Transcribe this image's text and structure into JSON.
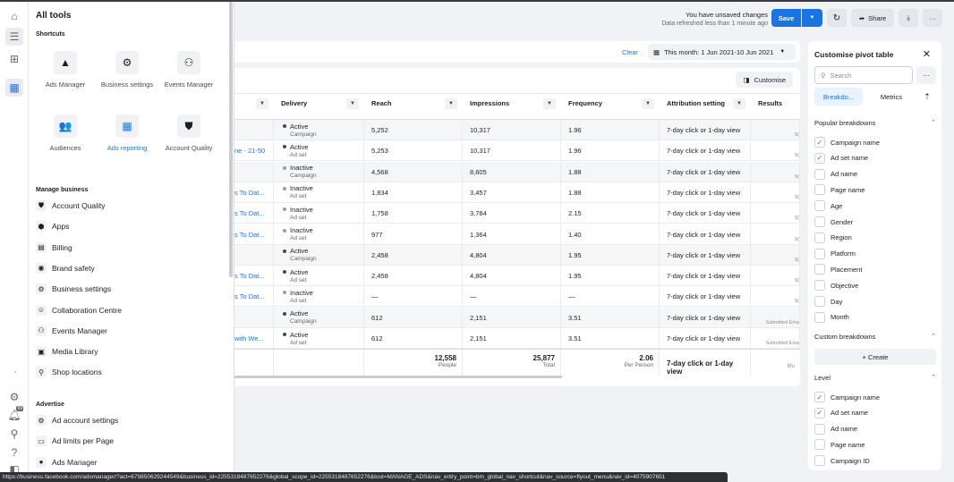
{
  "rail": {
    "icons": [
      "home-icon",
      "menu-icon",
      "notebook-add-icon",
      "ads-reporting-icon"
    ],
    "bottom_icons": [
      "settings-icon",
      "notifications-icon",
      "search-icon",
      "help-icon",
      "panel-icon"
    ],
    "notification_badge": "99"
  },
  "flyout": {
    "title": "All tools",
    "shortcuts_label": "Shortcuts",
    "shortcuts": [
      {
        "label": "Ads Manager",
        "icon": "ads-manager-icon",
        "glyph": "▲",
        "active": false
      },
      {
        "label": "Business settings",
        "icon": "gear-icon",
        "glyph": "⚙",
        "active": false
      },
      {
        "label": "Events Manager",
        "icon": "events-manager-icon",
        "glyph": "⚇",
        "active": false
      },
      {
        "label": "Audiences",
        "icon": "audiences-icon",
        "glyph": "👥",
        "active": false
      },
      {
        "label": "Ads reporting",
        "icon": "ads-reporting-icon",
        "glyph": "▦",
        "active": true
      },
      {
        "label": "Account Quality",
        "icon": "shield-icon",
        "glyph": "⛊",
        "active": false
      }
    ],
    "manage_label": "Manage business",
    "manage_items": [
      {
        "label": "Account Quality",
        "icon": "shield-icon",
        "glyph": "⛊"
      },
      {
        "label": "Apps",
        "icon": "apps-icon",
        "glyph": "⬢"
      },
      {
        "label": "Billing",
        "icon": "billing-icon",
        "glyph": "▤"
      },
      {
        "label": "Brand safety",
        "icon": "brand-safety-icon",
        "glyph": "◉"
      },
      {
        "label": "Business settings",
        "icon": "gear-icon",
        "glyph": "⚙"
      },
      {
        "label": "Collaboration Centre",
        "icon": "collaboration-icon",
        "glyph": "☺"
      },
      {
        "label": "Events Manager",
        "icon": "events-manager-icon",
        "glyph": "⚇"
      },
      {
        "label": "Media Library",
        "icon": "media-library-icon",
        "glyph": "▣"
      },
      {
        "label": "Shop locations",
        "icon": "shop-locations-icon",
        "glyph": "⚲"
      }
    ],
    "advertise_label": "Advertise",
    "advertise_items": [
      {
        "label": "Ad account settings",
        "icon": "ad-account-settings-icon",
        "glyph": "⚙"
      },
      {
        "label": "Ad limits per Page",
        "icon": "ad-limits-icon",
        "glyph": "▭"
      },
      {
        "label": "Ads Manager",
        "icon": "ads-manager-icon",
        "glyph": "●"
      }
    ]
  },
  "header": {
    "unsaved": "You have unsaved changes",
    "refreshed": "Data refreshed less than 1 minute ago",
    "save": "Save",
    "share": "Share"
  },
  "filter": {
    "clear": "Clear",
    "date_range": "This month: 1 Jun 2021-10 Jun 2021"
  },
  "table": {
    "customise": "Customise",
    "columns": [
      "",
      "Delivery",
      "Reach",
      "Impressions",
      "Frequency",
      "Attribution setting",
      "Results"
    ],
    "rows": [
      {
        "name": "",
        "status": "Active",
        "level": "Campaign",
        "reach": "5,252",
        "impressions": "10,317",
        "frequency": "1.96",
        "attribution": "7-day click or 1-day view",
        "results": "5(",
        "shade": true
      },
      {
        "name": "ne - 21-50",
        "status": "Active",
        "level": "Ad set",
        "reach": "5,253",
        "impressions": "10,317",
        "frequency": "1.96",
        "attribution": "7-day click or 1-day view",
        "results": "5(",
        "shade": false
      },
      {
        "name": "",
        "status": "Inactive",
        "level": "Campaign",
        "reach": "4,568",
        "impressions": "8,605",
        "frequency": "1.88",
        "attribution": "7-day click or 1-day view",
        "results": "5(",
        "shade": true
      },
      {
        "name": "s To Dat...",
        "status": "Inactive",
        "level": "Ad set",
        "reach": "1,834",
        "impressions": "3,457",
        "frequency": "1.88",
        "attribution": "7-day click or 1-day view",
        "results": "5(",
        "shade": false
      },
      {
        "name": "s To Dat...",
        "status": "Inactive",
        "level": "Ad set",
        "reach": "1,758",
        "impressions": "3,784",
        "frequency": "2.15",
        "attribution": "7-day click or 1-day view",
        "results": "5(",
        "shade": false
      },
      {
        "name": "s To Dat...",
        "status": "Inactive",
        "level": "Ad set",
        "reach": "977",
        "impressions": "1,364",
        "frequency": "1.40",
        "attribution": "7-day click or 1-day view",
        "results": "5(",
        "shade": false
      },
      {
        "name": "",
        "status": "Active",
        "level": "Campaign",
        "reach": "2,458",
        "impressions": "4,804",
        "frequency": "1.95",
        "attribution": "7-day click or 1-day view",
        "results": "5(",
        "shade": true
      },
      {
        "name": "s To Dat...",
        "status": "Active",
        "level": "Ad set",
        "reach": "2,458",
        "impressions": "4,804",
        "frequency": "1.95",
        "attribution": "7-day click or 1-day view",
        "results": "5(",
        "shade": false
      },
      {
        "name": "s To Dat...",
        "status": "Inactive",
        "level": "Ad set",
        "reach": "—",
        "impressions": "—",
        "frequency": "—",
        "attribution": "7-day click or 1-day view",
        "results": "5(",
        "shade": false
      },
      {
        "name": "",
        "status": "Active",
        "level": "Campaign",
        "reach": "612",
        "impressions": "2,151",
        "frequency": "3.51",
        "attribution": "7-day click or 1-day view",
        "results": "Submitted Ema",
        "shade": true
      },
      {
        "name": "with We...",
        "status": "Active",
        "level": "Ad set",
        "reach": "612",
        "impressions": "2,151",
        "frequency": "3.51",
        "attribution": "7-day click or 1-day view",
        "results": "Submitted Ema",
        "shade": false
      }
    ],
    "totals": {
      "reach": "12,558",
      "reach_sub": "People",
      "impressions": "25,877",
      "impressions_sub": "Total",
      "frequency": "2.06",
      "frequency_sub": "Per Person",
      "attribution": "7-day click or 1-day view",
      "results": "Mu"
    },
    "status_colors": {
      "Active": "#444950",
      "Inactive": "#9a9ea3"
    }
  },
  "pivot": {
    "title": "Customise pivot table",
    "search_placeholder": "Search",
    "tab_breakdowns": "Breakdo...",
    "tab_metrics": "Metrics",
    "popular_label": "Popular breakdowns",
    "popular": [
      {
        "label": "Campaign name",
        "checked": true
      },
      {
        "label": "Ad set name",
        "checked": true
      },
      {
        "label": "Ad name",
        "checked": false
      },
      {
        "label": "Page name",
        "checked": false
      },
      {
        "label": "Age",
        "checked": false
      },
      {
        "label": "Gender",
        "checked": false
      },
      {
        "label": "Region",
        "checked": false
      },
      {
        "label": "Platform",
        "checked": false
      },
      {
        "label": "Placement",
        "checked": false
      },
      {
        "label": "Objective",
        "checked": false
      },
      {
        "label": "Day",
        "checked": false
      },
      {
        "label": "Month",
        "checked": false
      }
    ],
    "custom_label": "Custom breakdowns",
    "create": "+ Create",
    "level_label": "Level",
    "level": [
      {
        "label": "Campaign name",
        "checked": true
      },
      {
        "label": "Ad set name",
        "checked": true
      },
      {
        "label": "Ad name",
        "checked": false
      },
      {
        "label": "Page name",
        "checked": false
      },
      {
        "label": "Campaign ID",
        "checked": false
      }
    ]
  },
  "status_url": "https://business.facebook.com/adsmanager/?act=679850629244549&business_id=2255318487652276&global_scope_id=2255318487652276&tool=MANAGE_ADS&nav_entry_point=bm_global_nav_shortcut&nav_source=flyout_menu&nav_id=4075907651"
}
